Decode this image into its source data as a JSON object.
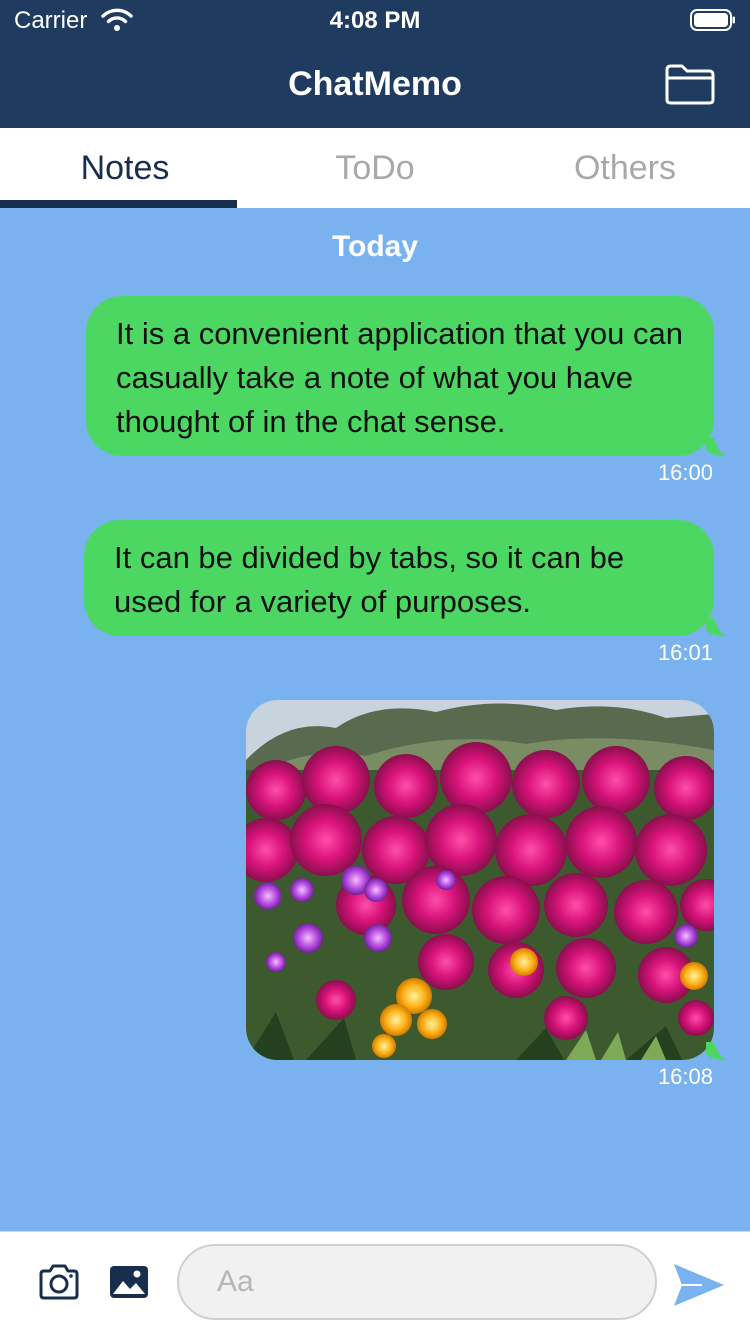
{
  "status_bar": {
    "carrier": "Carrier",
    "time": "4:08 PM"
  },
  "nav": {
    "title": "ChatMemo"
  },
  "tabs": [
    {
      "label": "Notes",
      "active": true
    },
    {
      "label": "ToDo",
      "active": false
    },
    {
      "label": "Others",
      "active": false
    }
  ],
  "chat": {
    "date_header": "Today",
    "messages": [
      {
        "type": "text",
        "text": "It is a convenient application that you can casually take a note of what you have thought of in the chat sense.",
        "time": "16:00"
      },
      {
        "type": "text",
        "text": "It can be divided by tabs, so it can be used for a variety of purposes.",
        "time": "16:01"
      },
      {
        "type": "image",
        "subject": "flower-field-photo",
        "time": "16:08"
      }
    ]
  },
  "input": {
    "placeholder": "Aa"
  },
  "colors": {
    "nav_bg": "#1f3c60",
    "chat_bg": "#79b2ee",
    "bubble_bg": "#4bd762",
    "tab_active": "#182e4d",
    "tab_inactive": "#a8a8a8",
    "send_icon": "#79b2ee"
  },
  "icons": {
    "folder": "folder-icon",
    "camera": "camera-icon",
    "photo": "photo-library-icon",
    "send": "send-icon",
    "wifi": "wifi-icon",
    "battery": "battery-icon"
  }
}
